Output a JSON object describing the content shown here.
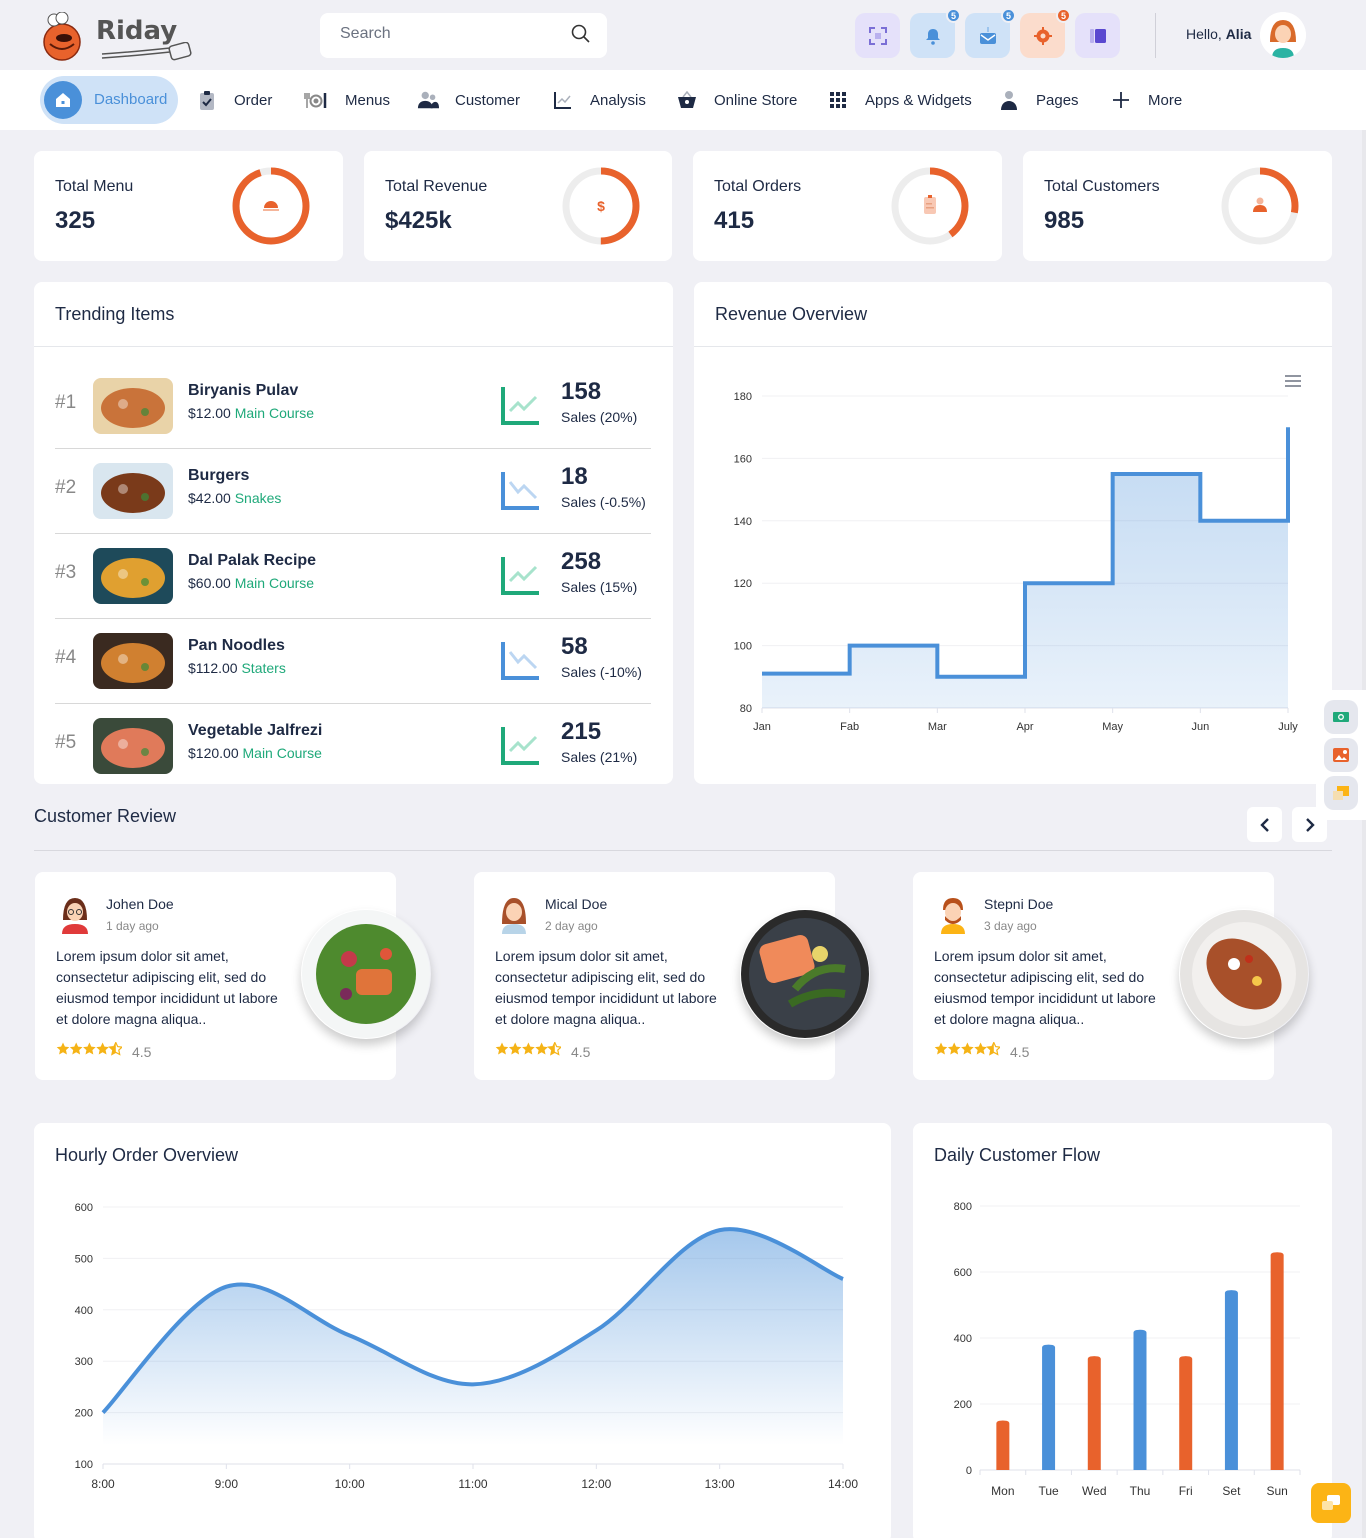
{
  "app": {
    "brand": "Riday"
  },
  "header": {
    "search_placeholder": "Search",
    "greeting_prefix": "Hello,",
    "user_name": "Alia",
    "icon_buttons": [
      {
        "name": "fullscreen",
        "badge": null,
        "color": "#7b6fd6",
        "bg": "#e5e1fa"
      },
      {
        "name": "notifications",
        "badge": "5",
        "color": "#4a90d9",
        "bg": "#cfe2f7"
      },
      {
        "name": "messages",
        "badge": "5",
        "color": "#4a90d9",
        "bg": "#cfe2f7"
      },
      {
        "name": "settings",
        "badge": "5",
        "color": "#e8622c",
        "bg": "#fbdccc"
      },
      {
        "name": "sidebar-toggle",
        "badge": null,
        "color": "#5a48d0",
        "bg": "#e5e1fa"
      }
    ]
  },
  "nav": {
    "items": [
      {
        "label": "Dashboard",
        "active": true
      },
      {
        "label": "Order"
      },
      {
        "label": "Menus"
      },
      {
        "label": "Customer"
      },
      {
        "label": "Analysis"
      },
      {
        "label": "Online Store"
      },
      {
        "label": "Apps & Widgets"
      },
      {
        "label": "Pages"
      },
      {
        "label": "More"
      }
    ]
  },
  "stats": [
    {
      "title": "Total Menu",
      "value": "325",
      "progress": 0.95
    },
    {
      "title": "Total Revenue",
      "value": "$425k",
      "progress": 0.5
    },
    {
      "title": "Total Orders",
      "value": "415",
      "progress": 0.4
    },
    {
      "title": "Total Customers",
      "value": "985",
      "progress": 0.28
    }
  ],
  "trending": {
    "title": "Trending Items",
    "items": [
      {
        "rank": "#1",
        "name": "Biryanis Pulav",
        "price": "$12.00",
        "category": "Main Course",
        "count": "158",
        "sales": "Sales (20%)",
        "trend": "up"
      },
      {
        "rank": "#2",
        "name": "Burgers",
        "price": "$42.00",
        "category": "Snakes",
        "count": "18",
        "sales": "Sales (-0.5%)",
        "trend": "down"
      },
      {
        "rank": "#3",
        "name": "Dal Palak Recipe",
        "price": "$60.00",
        "category": "Main Course",
        "count": "258",
        "sales": "Sales (15%)",
        "trend": "up"
      },
      {
        "rank": "#4",
        "name": "Pan Noodles",
        "price": "$112.00",
        "category": "Staters",
        "count": "58",
        "sales": "Sales (-10%)",
        "trend": "down"
      },
      {
        "rank": "#5",
        "name": "Vegetable Jalfrezi",
        "price": "$120.00",
        "category": "Main Course",
        "count": "215",
        "sales": "Sales (21%)",
        "trend": "up"
      }
    ]
  },
  "reviews": {
    "title": "Customer Review",
    "items": [
      {
        "name": "Johen Doe",
        "time": "1 day ago",
        "text": "Lorem ipsum dolor sit amet, consectetur adipiscing elit, sed do eiusmod tempor incididunt ut labore et dolore magna aliqua..",
        "rating": "4.5"
      },
      {
        "name": "Mical Doe",
        "time": "2 day ago",
        "text": "Lorem ipsum dolor sit amet, consectetur adipiscing elit, sed do eiusmod tempor incididunt ut labore et dolore magna aliqua..",
        "rating": "4.5"
      },
      {
        "name": "Stepni Doe",
        "time": "3 day ago",
        "text": "Lorem ipsum dolor sit amet, consectetur adipiscing elit, sed do eiusmod tempor incididunt ut labore et dolore magna aliqua..",
        "rating": "4.5"
      }
    ]
  },
  "chart_data": [
    {
      "id": "revenue",
      "type": "area",
      "step": true,
      "title": "Revenue Overview",
      "categories": [
        "Jan",
        "Fab",
        "Mar",
        "Apr",
        "May",
        "Jun",
        "July"
      ],
      "values": [
        91,
        100,
        90,
        120,
        155,
        140,
        170
      ],
      "ylim": [
        80,
        180
      ],
      "yticks": [
        80,
        100,
        120,
        140,
        160,
        180
      ],
      "color": "#4a90d9",
      "grid": true
    },
    {
      "id": "hourly",
      "type": "area",
      "smooth": true,
      "title": "Hourly Order Overview",
      "categories": [
        "8:00",
        "9:00",
        "10:00",
        "11:00",
        "12:00",
        "13:00",
        "14:00"
      ],
      "values": [
        200,
        445,
        350,
        255,
        360,
        555,
        460
      ],
      "ylim": [
        100,
        600
      ],
      "yticks": [
        100,
        200,
        300,
        400,
        500,
        600
      ],
      "color": "#4a90d9",
      "grid": true
    },
    {
      "id": "daily",
      "type": "bar",
      "title": "Daily Customer Flow",
      "categories": [
        "Mon",
        "Tue",
        "Wed",
        "Thu",
        "Fri",
        "Set",
        "Sun"
      ],
      "values": [
        150,
        380,
        345,
        425,
        345,
        545,
        660
      ],
      "colors": [
        "#e8622c",
        "#4a90d9",
        "#e8622c",
        "#4a90d9",
        "#e8622c",
        "#4a90d9",
        "#e8622c"
      ],
      "ylim": [
        0,
        800
      ],
      "yticks": [
        0,
        200,
        400,
        600,
        800
      ],
      "grid": true
    }
  ]
}
